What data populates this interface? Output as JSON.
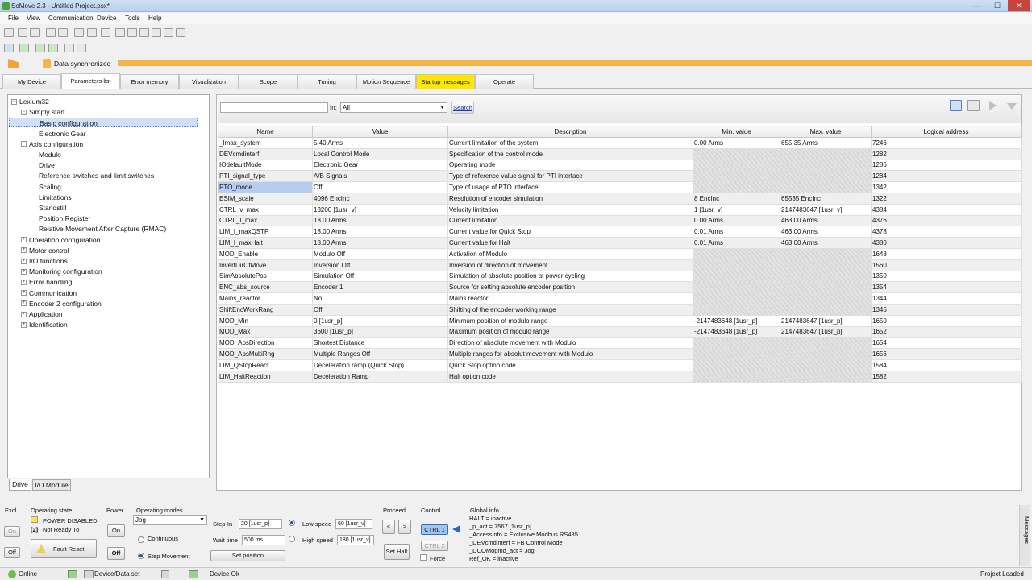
{
  "window": {
    "title": "SoMove 2.3 - Untitled Project.psx*"
  },
  "menu": [
    "File",
    "View",
    "Communication",
    "Device",
    "Tools",
    "Help"
  ],
  "sync": {
    "label": "Data synchronized"
  },
  "tabs": [
    "My Device",
    "Parameters list",
    "Error memory",
    "Visualization",
    "Scope",
    "Tuning",
    "Motion Sequence",
    "Startup messages",
    "Operate"
  ],
  "tree": [
    {
      "label": "Lexium32",
      "depth": 0,
      "exp": "−"
    },
    {
      "label": "Simply start",
      "depth": 1,
      "exp": "−"
    },
    {
      "label": "Basic configuration",
      "depth": 2,
      "sel": true
    },
    {
      "label": "Electronic Gear",
      "depth": 2
    },
    {
      "label": "Axis configuration",
      "depth": 1,
      "exp": "−"
    },
    {
      "label": "Modulo",
      "depth": 2
    },
    {
      "label": "Drive",
      "depth": 2
    },
    {
      "label": "Reference switches and limit switches",
      "depth": 2
    },
    {
      "label": "Scaling",
      "depth": 2
    },
    {
      "label": "Limitations",
      "depth": 2
    },
    {
      "label": "Standstill",
      "depth": 2
    },
    {
      "label": "Position Register",
      "depth": 2
    },
    {
      "label": "Relative Movement After Capture (RMAC)",
      "depth": 2
    },
    {
      "label": "Operation configuration",
      "depth": 1,
      "exp": "+"
    },
    {
      "label": "Motor control",
      "depth": 1,
      "exp": "+"
    },
    {
      "label": "I/O functions",
      "depth": 1,
      "exp": "+"
    },
    {
      "label": "Monitoring configuration",
      "depth": 1,
      "exp": "+"
    },
    {
      "label": "Error handling",
      "depth": 1,
      "exp": "+"
    },
    {
      "label": "Communication",
      "depth": 1,
      "exp": "+"
    },
    {
      "label": "Encoder 2 configuration",
      "depth": 1,
      "exp": "+"
    },
    {
      "label": "Application",
      "depth": 1,
      "exp": "+"
    },
    {
      "label": "Identification",
      "depth": 1,
      "exp": "+"
    }
  ],
  "bottom_tabs": [
    "Drive",
    "I/O Module"
  ],
  "search": {
    "in_label": "In:",
    "scope": "All",
    "button": "Search"
  },
  "table": {
    "columns": [
      "Name",
      "Value",
      "Description",
      "Min. value",
      "Max. value",
      "Logical address"
    ],
    "rows": [
      [
        "_Imax_system",
        "5.40 Arms",
        "Current limitation of the system",
        "0.00 Arms",
        "655.35 Arms",
        "7246"
      ],
      [
        "DEVcmdinterf",
        "Local Control Mode",
        "Specification of the control mode",
        "",
        "",
        "1282"
      ],
      [
        "IOdefaultMode",
        "Electronic Gear",
        "Operating mode",
        "",
        "",
        "1286"
      ],
      [
        "PTI_signal_type",
        "A/B Signals",
        "Type of reference value signal for PTI interface",
        "",
        "",
        "1284"
      ],
      [
        "PTO_mode",
        "Off",
        "Type of usage of PTO interface",
        "",
        "",
        "1342"
      ],
      [
        "ESIM_scale",
        "4096 EncInc",
        "Resolution of encoder simulation",
        "8 EncInc",
        "65535 EncInc",
        "1322"
      ],
      [
        "CTRL_v_max",
        "13200 [1usr_v]",
        "Velocity limitation",
        "1 [1usr_v]",
        "2147483647 [1usr_v]",
        "4384"
      ],
      [
        "CTRL_I_max",
        "18.00 Arms",
        "Current limitation",
        "0.00 Arms",
        "463.00 Arms",
        "4376"
      ],
      [
        "LIM_I_maxQSTP",
        "18.00 Arms",
        "Current value for Quick Stop",
        "0.01 Arms",
        "463.00 Arms",
        "4378"
      ],
      [
        "LIM_I_maxHalt",
        "18.00 Arms",
        "Current value for Halt",
        "0.01 Arms",
        "463.00 Arms",
        "4380"
      ],
      [
        "MOD_Enable",
        "Modulo Off",
        "Activation of Modulo",
        "",
        "",
        "1648"
      ],
      [
        "InvertDirOfMove",
        "Inversion Off",
        "Inversion of direction of movement",
        "",
        "",
        "1560"
      ],
      [
        "SimAbsolutePos",
        "Simulation Off",
        "Simulation of absolute position at power cycling",
        "",
        "",
        "1350"
      ],
      [
        "ENC_abs_source",
        "Encoder 1",
        "Source for setting absolute encoder position",
        "",
        "",
        "1354"
      ],
      [
        "Mains_reactor",
        "No",
        "Mains reactor",
        "",
        "",
        "1344"
      ],
      [
        "ShiftEncWorkRang",
        "Off",
        "Shifting of the encoder working range",
        "",
        "",
        "1346"
      ],
      [
        "MOD_Min",
        "0 [1usr_p]",
        "Minimum position of modulo range",
        "-2147483648 [1usr_p]",
        "2147483647 [1usr_p]",
        "1650"
      ],
      [
        "MOD_Max",
        "3600 [1usr_p]",
        "Maximum position of modulo range",
        "-2147483648 [1usr_p]",
        "2147483647 [1usr_p]",
        "1652"
      ],
      [
        "MOD_AbsDirection",
        "Shortest Distance",
        "Direction of absolute movement with Modulo",
        "",
        "",
        "1654"
      ],
      [
        "MOD_AbsMultiRng",
        "Multiple Ranges Off",
        "Multiple ranges for absolut movement with Modulo",
        "",
        "",
        "1656"
      ],
      [
        "LIM_QStopReact",
        "Deceleration ramp (Quick Stop)",
        "Quick Stop option code",
        "",
        "",
        "1584"
      ],
      [
        "LIM_HaltReaction",
        "Deceleration Ramp",
        "Halt option code",
        "",
        "",
        "1582"
      ]
    ]
  },
  "bottom": {
    "excl": "Excl.",
    "on": "On",
    "off": "Off",
    "opstate_title": "Operating state",
    "opstate1": "POWER DISABLED",
    "opstate_num": "[2]",
    "opstate2": "Not Ready To",
    "fault_reset": "Fault Reset",
    "power": "Power",
    "power_on": "On",
    "power_off": "Off",
    "opmodes": "Operating modes",
    "mode_value": "Jog",
    "continuous": "Continuous",
    "step_movement": "Step Movement",
    "step_in": "Step-In",
    "step_in_val": "20 [1usr_p]",
    "wait_time": "Wait time",
    "wait_val": "500 ms",
    "set_position": "Set position",
    "low_speed": "Low speed",
    "low_val": "60 [1usr_v]",
    "high_speed": "High speed",
    "high_val": "180 [1usr_v]",
    "proceed": "Proceed",
    "set_halt": "Set Halt",
    "control": "Control",
    "ctrl1": "CTRL 1",
    "ctrl2": "CTRL 2",
    "force": "Force",
    "global_info": "Global info",
    "global_lines": [
      "HALT = inactive",
      "_p_act = 7567 [1usr_p]",
      "_AccessInfo = Exclusive Modbus RS485",
      "_DEVcmdinterf = FB Control Mode",
      "_DCOMopmd_act = Jog",
      "Ref_OK = inactive"
    ],
    "messages": "Messages"
  },
  "status": {
    "online": "Online",
    "device": "Device/Data set",
    "device_ok": "Device Ok",
    "project": "Project Loaded"
  }
}
